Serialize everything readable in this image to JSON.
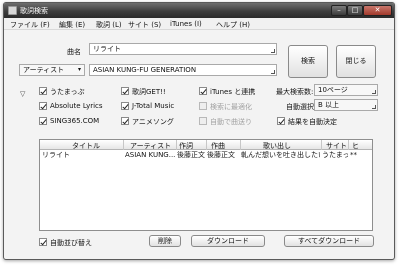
{
  "window": {
    "title": "歌詞検索"
  },
  "menu": [
    {
      "label": "ファイル (F)"
    },
    {
      "label": "編集 (E)"
    },
    {
      "label": "歌詞 (L)"
    },
    {
      "label": "サイト (S)"
    },
    {
      "label": "iTunes (I)"
    },
    {
      "label": "ヘルプ (H)"
    }
  ],
  "search": {
    "song_label": "曲名",
    "song_value": "リライト",
    "mode_select": "アーティスト",
    "artist_value": "ASIAN KUNG-FU GENERATION",
    "search_button": "検索",
    "close_button": "閉じる"
  },
  "sites": [
    {
      "label": "うたまっぷ",
      "checked": true
    },
    {
      "label": "歌詞GET!!",
      "checked": true
    },
    {
      "label": "Absolute Lyrics",
      "checked": true
    },
    {
      "label": "J-Total Music",
      "checked": true
    },
    {
      "label": "SING365.COM",
      "checked": true
    },
    {
      "label": "アニメソング",
      "checked": true
    }
  ],
  "itunes_options": [
    {
      "label": "iTunes と連携",
      "checked": true,
      "disabled": false
    },
    {
      "label": "検索に最適化",
      "checked": false,
      "disabled": true
    },
    {
      "label": "自動で曲送り",
      "checked": false,
      "disabled": true
    }
  ],
  "settings": {
    "max_results_label": "最大検索数:",
    "max_results_value": "10ページ",
    "auto_select_label": "自動選択:",
    "auto_select_value": "B 以上",
    "auto_decide_label": "結果を自動決定",
    "auto_decide_checked": true
  },
  "table": {
    "columns": [
      "タイトル",
      "アーティスト",
      "作詞",
      "作曲",
      "歌い出し",
      "サイト",
      "ヒ"
    ],
    "rows": [
      [
        "リライト",
        "ASIAN KUNG...",
        "後藤正文",
        "後藤正文",
        "軋んだ想いを吐き出したい...",
        "うたまっ...",
        "**"
      ]
    ]
  },
  "footer": {
    "auto_sort_label": "自動並び替え",
    "auto_sort_checked": true,
    "delete_button": "削除",
    "download_button": "ダウンロード",
    "download_all_button": "すべてダウンロード"
  }
}
